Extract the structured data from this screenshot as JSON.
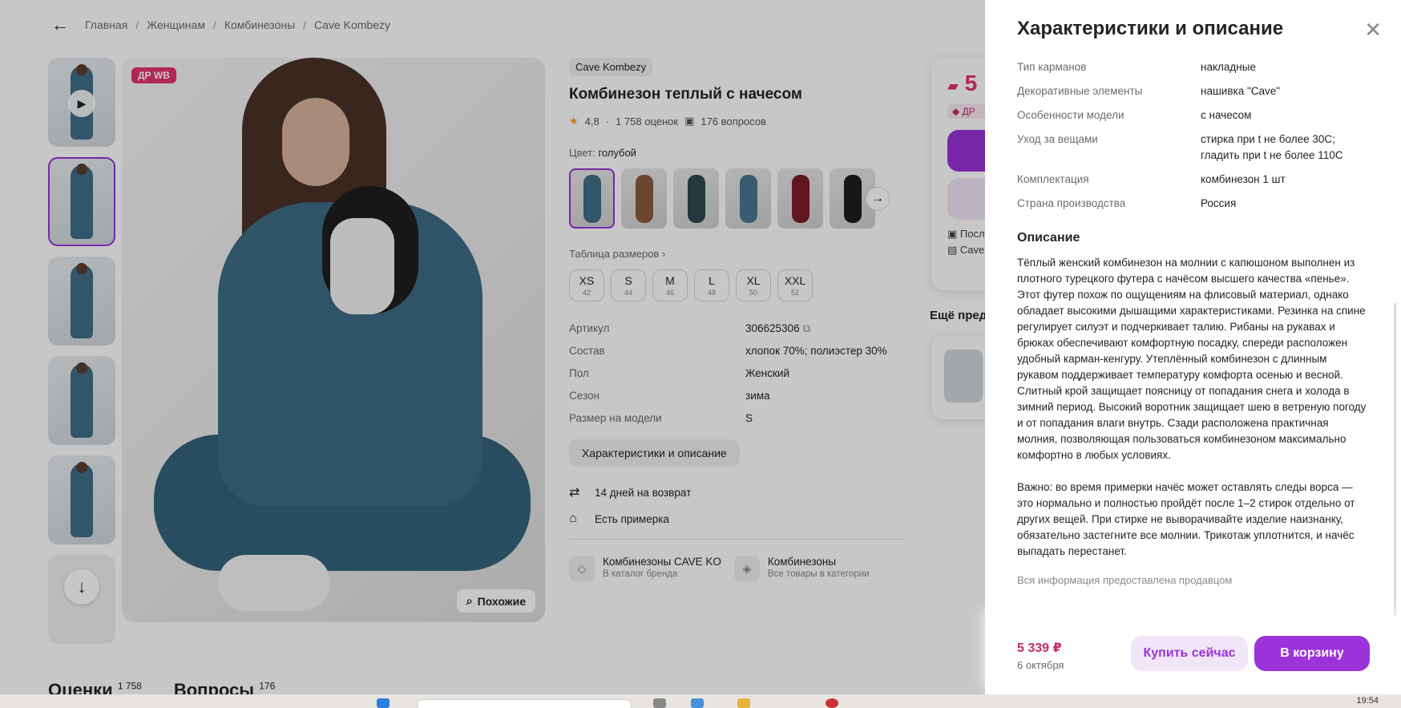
{
  "breadcrumb": {
    "items": [
      "Главная",
      "Женщинам",
      "Комбинезоны",
      "Cave Kombezy"
    ],
    "separator": "/"
  },
  "gallery": {
    "badge": "ДР WB",
    "similar_label": "Похожие"
  },
  "product": {
    "brand": "Cave Kombezy",
    "title": "Комбинезон теплый с начесом",
    "rating": "4,8",
    "reviews": "1 758 оценок",
    "questions": "176 вопросов",
    "color_label": "Цвет:",
    "color_value": "голубой",
    "size_table_label": "Таблица размеров",
    "sizes": [
      {
        "name": "XS",
        "num": "42"
      },
      {
        "name": "S",
        "num": "44"
      },
      {
        "name": "M",
        "num": "46"
      },
      {
        "name": "L",
        "num": "48"
      },
      {
        "name": "XL",
        "num": "50"
      },
      {
        "name": "XXL",
        "num": "52"
      }
    ],
    "specs": [
      {
        "k": "Артикул",
        "v": "306625306"
      },
      {
        "k": "Состав",
        "v": "хлопок 70%; полиэстер 30%"
      },
      {
        "k": "Пол",
        "v": "Женский"
      },
      {
        "k": "Сезон",
        "v": "зима"
      },
      {
        "k": "Размер на модели",
        "v": "S"
      }
    ],
    "char_button": "Характеристики и описание",
    "perks": [
      "14 дней на возврат",
      "Есть примерка"
    ],
    "links": [
      {
        "title": "Комбинезоны CAVE KO",
        "sub": "В каталог бренда"
      },
      {
        "title": "Комбинезоны",
        "sub": "Все товары в категории"
      }
    ]
  },
  "pricecard": {
    "price_partial": "5",
    "dr_partial": "ДР",
    "line1": "Посл",
    "line2": "Cave"
  },
  "more_title": "Ещё пред",
  "bottom_tabs": [
    {
      "label": "Оценки",
      "count": "1 758"
    },
    {
      "label": "Вопросы",
      "count": "176"
    }
  ],
  "drawer": {
    "title": "Характеристики и описание",
    "rows": [
      {
        "k": "Тип карманов",
        "v": "накладные"
      },
      {
        "k": "Декоративные элементы",
        "v": "нашивка \"Cave\""
      },
      {
        "k": "Особенности модели",
        "v": "с начесом"
      },
      {
        "k": "Уход за вещами",
        "v": "стирка при t не более 30С; гладить при t не более 110С"
      },
      {
        "k": "Комплектация",
        "v": "комбинезон 1 шт"
      },
      {
        "k": "Страна производства",
        "v": "Россия"
      }
    ],
    "desc_title": "Описание",
    "desc_p1": "Тёплый женский комбинезон на молнии с капюшоном выполнен из плотного турецкого футера с начёсом высшего качества «пенье». Этот футер похож по ощущениям на флисовый материал, однако обладает высокими дышащими характеристиками. Резинка на спине регулирует силуэт и подчеркивает талию. Рибаны на рукавах и брюках обеспечивают комфортную посадку, спереди расположен удобный карман-кенгуру. Утеплённый комбинезон с длинным рукавом поддерживает температуру комфорта осенью и весной. Слитный крой защищает поясницу от попадания снега и холода в зимний период. Высокий воротник защищает шею в ветреную погоду и от попадания влаги внутрь. Сзади расположена практичная молния, позволяющая пользоваться комбинезоном максимально комфортно в любых условиях.",
    "desc_p2": "Важно: во время примерки начёс может оставлять следы ворса — это нормально и полностью пройдёт после 1–2 стирок отдельно от других вещей. При стирке не выворачивайте изделие наизнанку, обязательно застегните все молнии. Трикотаж уплотнится, и начёс выпадать перестанет.",
    "note": "Вся информация предоставлена продавцом",
    "price": "5 339 ₽",
    "date": "6 октября",
    "buy_now": "Купить сейчас",
    "to_cart": "В корзину"
  },
  "taskbar": {
    "clock": "19:54"
  },
  "colors": {
    "accent": "#9b33d9",
    "price": "#c32a6a",
    "badge": "#e3346f",
    "swatches": [
      "#3f6e87",
      "#8a5a3f",
      "#2f4a4f",
      "#4a7690",
      "#7a1d2a",
      "#1e1e1e"
    ]
  }
}
